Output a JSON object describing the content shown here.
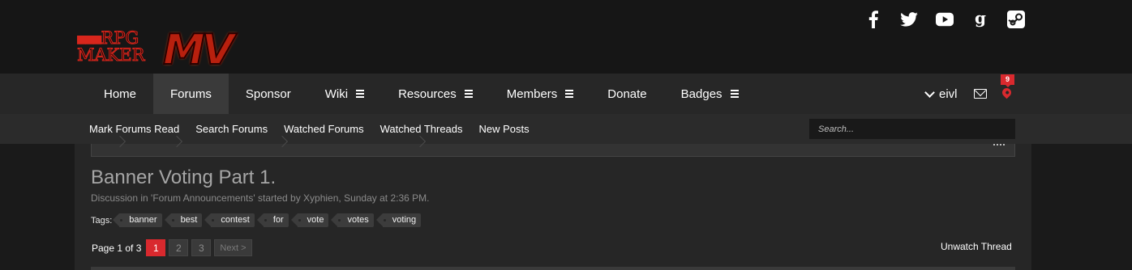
{
  "brand": {
    "logo_line1": "RPG",
    "logo_line2": "MAKER",
    "logo_mv": "MV",
    "logo_dots": "■■■"
  },
  "social": [
    {
      "name": "facebook-icon",
      "glyph": "f"
    },
    {
      "name": "twitter-icon",
      "glyph": "t"
    },
    {
      "name": "youtube-icon",
      "glyph": "▶"
    },
    {
      "name": "google-icon",
      "glyph": "g"
    },
    {
      "name": "steam-icon",
      "glyph": "s"
    }
  ],
  "nav": {
    "tabs": [
      {
        "label": "Home",
        "menu": false
      },
      {
        "label": "Forums",
        "menu": false,
        "active": true
      },
      {
        "label": "Sponsor",
        "menu": false
      },
      {
        "label": "Wiki",
        "menu": true
      },
      {
        "label": "Resources",
        "menu": true
      },
      {
        "label": "Members",
        "menu": true
      },
      {
        "label": "Donate",
        "menu": false
      },
      {
        "label": "Badges",
        "menu": true
      }
    ],
    "username": "eivl",
    "alerts_count": "9"
  },
  "subnav": {
    "items": [
      "Mark Forums Read",
      "Search Forums",
      "Watched Forums",
      "Watched Threads",
      "New Posts"
    ],
    "search_placeholder": "Search..."
  },
  "thread": {
    "title": "Banner Voting Part 1.",
    "description": "Discussion in 'Forum Announcements' started by Xyphien, Sunday at 2:36 PM.",
    "tags_label": "Tags:",
    "tags": [
      "banner",
      "best",
      "contest",
      "for",
      "vote",
      "votes",
      "voting"
    ]
  },
  "pagination": {
    "label": "Page 1 of 3",
    "pages": [
      "1",
      "2",
      "3"
    ],
    "current": "1",
    "next_label": "Next >"
  },
  "unwatch_label": "Unwatch Thread",
  "colors": {
    "accent": "#d9292e",
    "bg": "#1a1a1a",
    "band": "#272727"
  }
}
